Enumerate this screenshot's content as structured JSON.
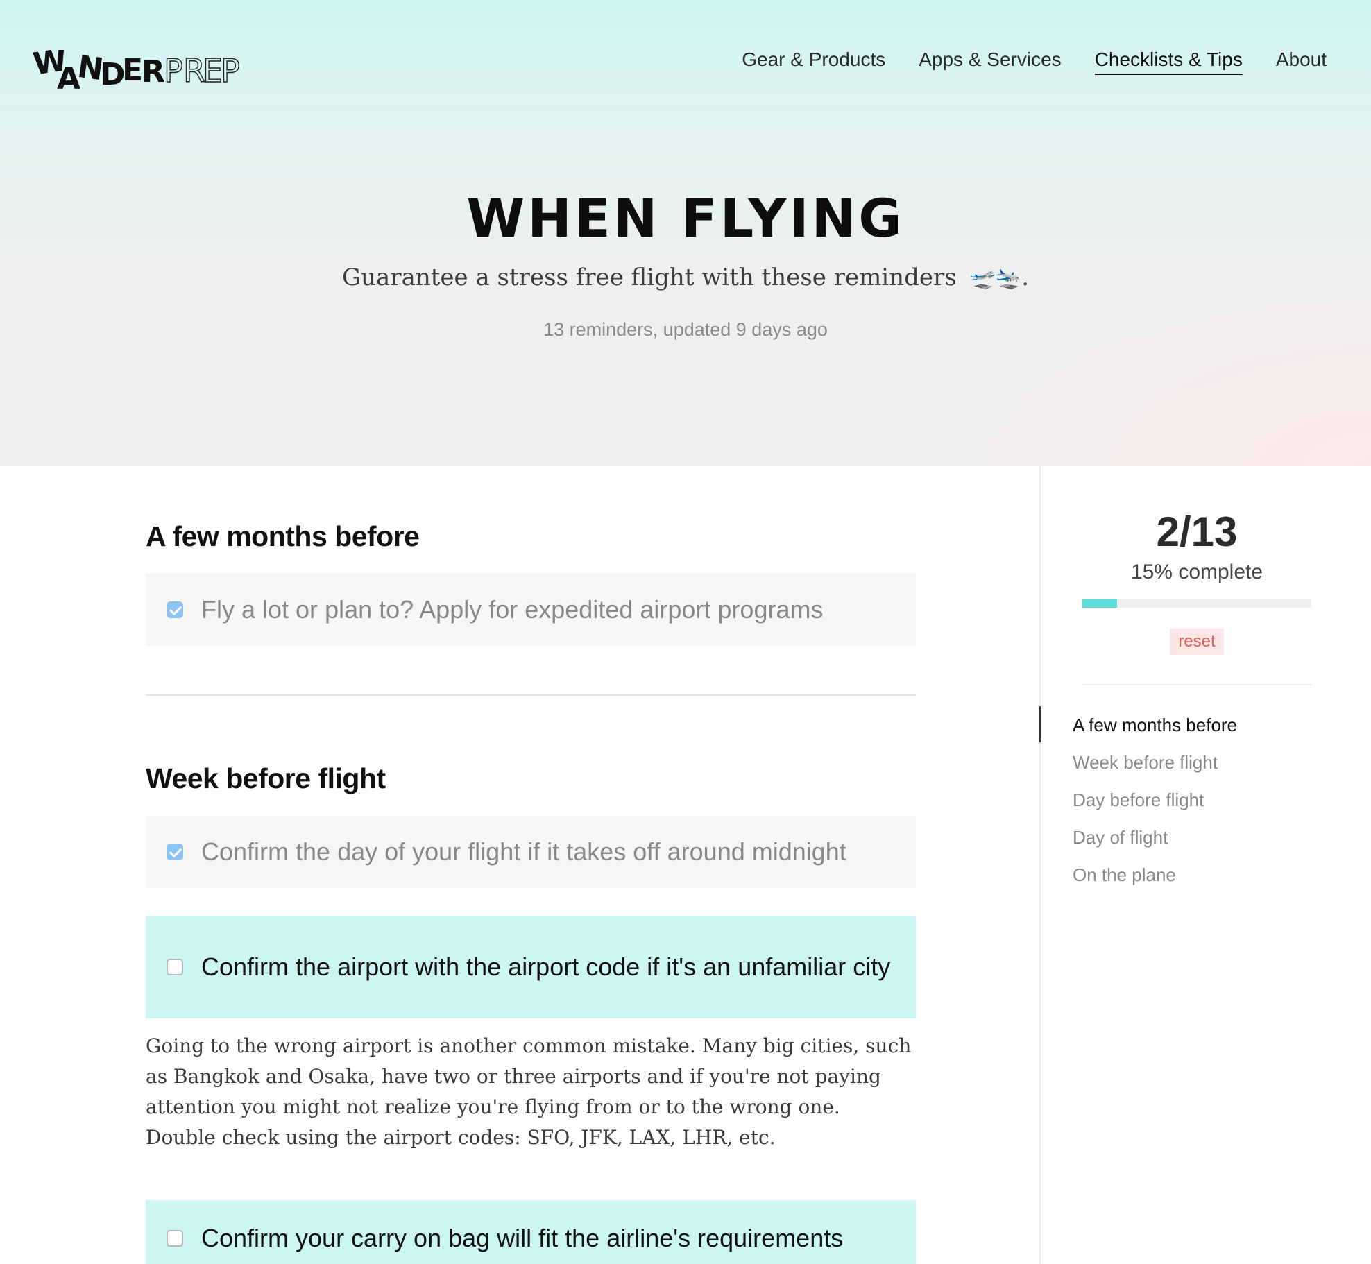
{
  "logo": {
    "text_dark": "WANDER",
    "text_outline": "PREP"
  },
  "nav": {
    "items": [
      {
        "label": "Gear & Products"
      },
      {
        "label": "Apps & Services"
      },
      {
        "label": "Checklists & Tips"
      },
      {
        "label": "About"
      }
    ],
    "active": "Checklists & Tips"
  },
  "hero": {
    "title": "WHEN FLYING",
    "subtitle": "Guarantee a stress free flight with these reminders",
    "subtitle_emoji": "🛫🛬",
    "subtitle_end": ".",
    "meta": "13 reminders, updated 9 days ago"
  },
  "sections": [
    {
      "title": "A few months before",
      "items": [
        {
          "label": "Fly a lot or plan to? Apply for expedited airport programs",
          "checked": true
        }
      ]
    },
    {
      "title": "Week before flight",
      "items": [
        {
          "label": "Confirm the day of your flight if it takes off around midnight",
          "checked": true
        },
        {
          "label": "Confirm the airport with the airport code if it's an unfamiliar city",
          "checked": false,
          "description": "Going to the wrong airport is another common mistake. Many big cities, such as Bangkok and Osaka, have two or three airports and if you're not paying attention you might not realize you're flying from or to the wrong one. Double check using the airport codes: SFO, JFK, LAX, LHR, etc."
        },
        {
          "label": "Confirm your carry on bag will fit the airline's requirements",
          "checked": false
        }
      ]
    }
  ],
  "progress": {
    "count": "2/13",
    "percent_label": "15% complete",
    "fraction": 0.15,
    "reset_label": "reset"
  },
  "toc": {
    "items": [
      "A few months before",
      "Week before flight",
      "Day before flight",
      "Day of flight",
      "On the plane"
    ],
    "active": "A few months before"
  },
  "colors": {
    "accent": "#5fded9",
    "open_item_bg": "#cbf6f4",
    "done_item_bg": "#f7f6f5",
    "checkbox_checked": "#8dc3f3",
    "reset_bg": "#fde7e6",
    "reset_text": "#e05c56"
  }
}
